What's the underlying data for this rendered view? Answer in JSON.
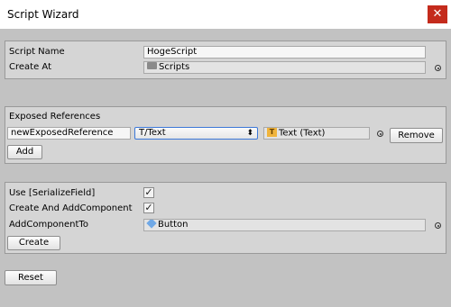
{
  "window": {
    "title": "Script Wizard",
    "close_glyph": "✕"
  },
  "script_panel": {
    "script_name_label": "Script Name",
    "script_name_value": "HogeScript",
    "create_at_label": "Create At",
    "create_at_value": "Scripts",
    "create_at_icon": "folder-icon"
  },
  "exposed_panel": {
    "header": "Exposed References",
    "reference_name": "newExposedReference",
    "type_selected": "T/Text",
    "object_value": "Text (Text)",
    "object_icon": "text-component-icon",
    "remove_label": "Remove",
    "add_label": "Add"
  },
  "component_panel": {
    "serialize_field_label": "Use [SerializeField]",
    "serialize_field_checked": true,
    "create_add_label": "Create And AddComponent",
    "create_add_checked": true,
    "add_component_to_label": "AddComponentTo",
    "add_component_to_value": "Button",
    "add_component_to_icon": "gameobject-cube-icon",
    "create_label": "Create"
  },
  "reset_label": "Reset",
  "checkmark_glyph": "✓",
  "dropdown_arrow_glyph": "⬍",
  "colors": {
    "close_button": "#c42b1c",
    "background": "#c2c2c2",
    "panel": "#d5d5d5",
    "select_border": "#3c78d8"
  }
}
